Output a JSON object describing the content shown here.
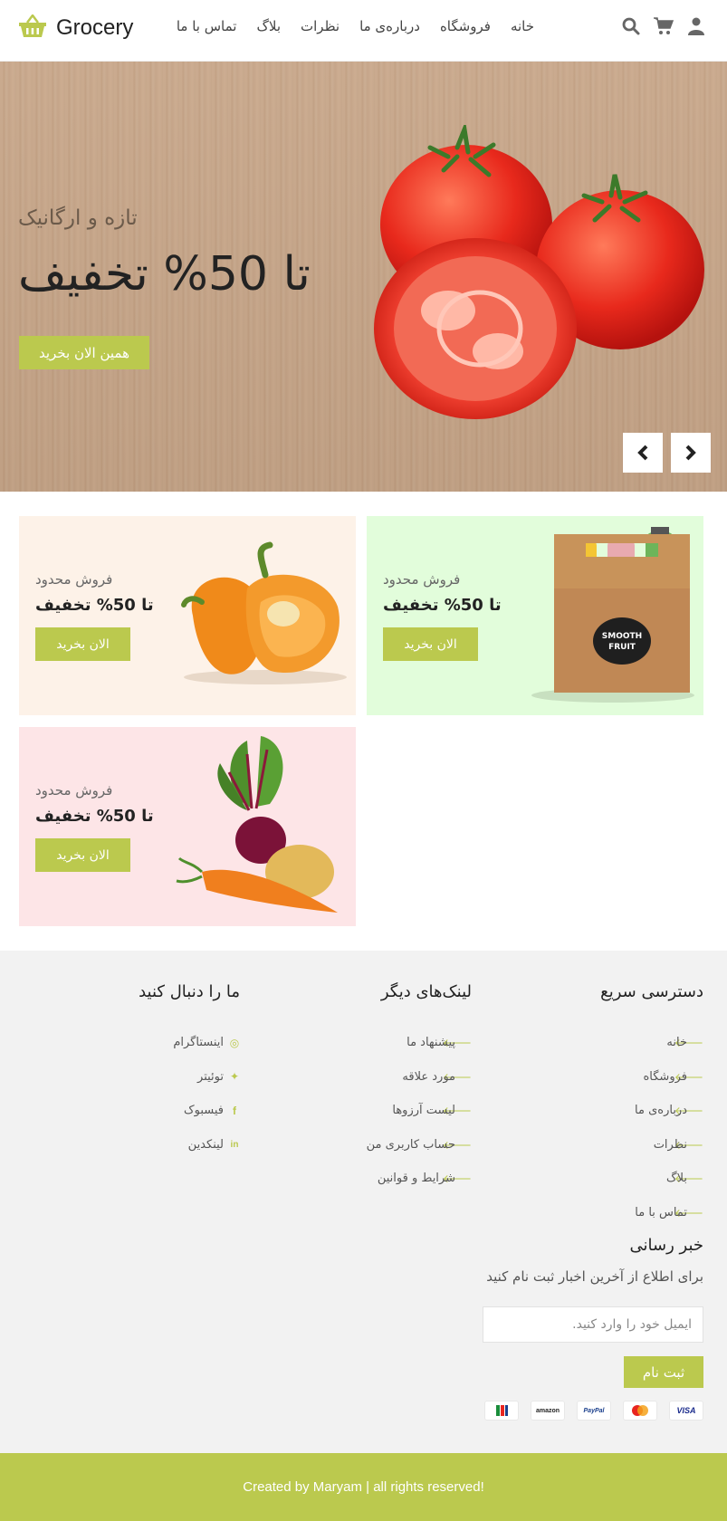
{
  "header": {
    "logo_text": "Grocery",
    "nav": [
      "خانه",
      "فروشگاه",
      "درباره‌ی ما",
      "نظرات",
      "بلاگ",
      "تماس با ما"
    ],
    "icons": [
      "user-icon",
      "cart-icon",
      "search-icon"
    ]
  },
  "hero": {
    "subtitle": "تازه و ارگانیک",
    "title": "تا 50% تخفیف",
    "button": "همین الان بخرید",
    "prev_icon": "chevron-left-icon",
    "next_icon": "chevron-right-icon"
  },
  "cards": [
    {
      "subtitle": "فروش محدود",
      "title": "تا 50% تخفیف",
      "button": "الان بخرید",
      "bg": "#fdf2e8",
      "image": "pepper"
    },
    {
      "subtitle": "فروش محدود",
      "title": "تا 50% تخفیف",
      "button": "الان بخرید",
      "bg": "#e2fddb",
      "image": "juice-box"
    },
    {
      "subtitle": "فروش محدود",
      "title": "تا 50% تخفیف",
      "button": "الان بخرید",
      "bg": "#fde5e7",
      "image": "vegetables"
    }
  ],
  "footer": {
    "quick_access": {
      "title": "دسترسی سریع",
      "items": [
        "خانه",
        "فروشگاه",
        "درباره‌ی ما",
        "نظرات",
        "بلاگ",
        "تماس با ما"
      ]
    },
    "other_links": {
      "title": "لینک‌های دیگر",
      "items": [
        "پیشنهاد ما",
        "مورد علاقه",
        "لیست آرزوها",
        "حساب کاربری من",
        "شرایط و قوانین"
      ]
    },
    "follow": {
      "title": "ما را دنبال کنید",
      "items": [
        {
          "label": "اینستاگرام",
          "icon": "instagram-icon"
        },
        {
          "label": "توئیتر",
          "icon": "twitter-icon"
        },
        {
          "label": "فیسبوک",
          "icon": "facebook-icon"
        },
        {
          "label": "لینکدین",
          "icon": "linkedin-icon"
        }
      ]
    },
    "newsletter": {
      "title": "خبر رسانی",
      "text": "برای اطلاع از آخرین اخبار ثبت نام کنید",
      "placeholder": "ایمیل خود را وارد کنید.",
      "button": "ثبت نام"
    },
    "payments": [
      "visa",
      "mastercard",
      "paypal",
      "amazon",
      "other"
    ]
  },
  "copyright": "Created by Maryam | all rights reserved!",
  "colors": {
    "accent": "#bbc94e",
    "hero_wood": "#c5a487"
  }
}
